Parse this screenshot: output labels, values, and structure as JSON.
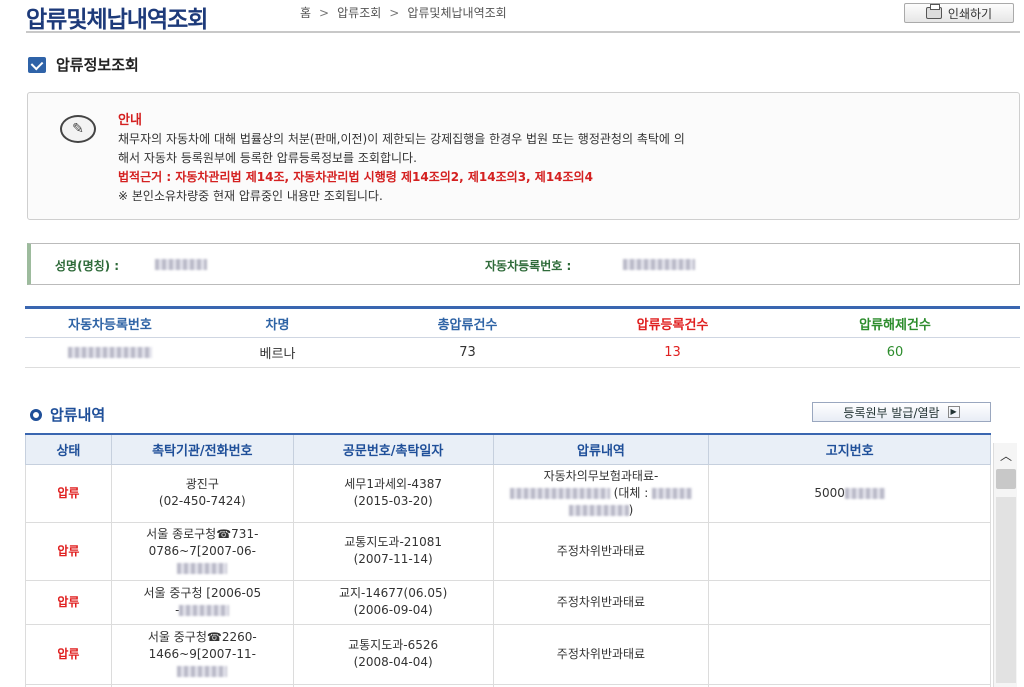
{
  "header": {
    "title": "압류및체납내역조회",
    "breadcrumb": [
      "홈",
      "압류조회",
      "압류및체납내역조회"
    ],
    "print_label": "인쇄하기"
  },
  "section": {
    "title": "압류정보조회"
  },
  "notice": {
    "title": "안내",
    "line1": "채무자의 자동차에 대해 법률상의 처분(판매,이전)이 제한되는 강제집행을 한경우 법원 또는 행정관청의 촉탁에 의",
    "line2": "해서 자동차 등록원부에 등록한 압류등록정보를 조회합니다.",
    "law": "법적근거 : 자동차관리법 제14조, 자동차관리법 시행령 제14조의2, 제14조의3, 제14조의4",
    "note": "※ 본인소유차량중 현재 압류중인 내용만 조회됩니다."
  },
  "owner": {
    "name_label": "성명(명칭) :",
    "reg_label": "자동차등록번호 :"
  },
  "summary": {
    "headers": [
      "자동차등록번호",
      "차명",
      "총압류건수",
      "압류등록건수",
      "압류해제건수"
    ],
    "car_name": "베르나",
    "total": "73",
    "registered": "13",
    "released": "60"
  },
  "list": {
    "title": "압류내역",
    "register_button": "등록원부 발급/열람",
    "headers": [
      "상태",
      "촉탁기관/전화번호",
      "공문번호/촉탁일자",
      "압류내역",
      "고지번호"
    ],
    "rows": [
      {
        "status": "압류",
        "agency": "광진구",
        "agency2": "(02-450-7424)",
        "doc": "세무1과세외-4387",
        "doc2": "(2015-03-20)",
        "detail": "자동차의무보험과태료-",
        "detail2": "(대체 :",
        "notice_no": "5000"
      },
      {
        "status": "압류",
        "agency": "서울 종로구청☎731-",
        "agency2": "0786~7[2007-06-",
        "doc": "교통지도과-21081",
        "doc2": "(2007-11-14)",
        "detail": "주정차위반과태료",
        "notice_no": ""
      },
      {
        "status": "압류",
        "agency": "서울 중구청 [2006-05",
        "agency2": "-",
        "doc": "교지-14677(06.05)",
        "doc2": "(2006-09-04)",
        "detail": "주정차위반과태료",
        "notice_no": ""
      },
      {
        "status": "압류",
        "agency": "서울 중구청☎2260-",
        "agency2": "1466~9[2007-11-",
        "doc": "교통지도과-6526",
        "doc2": "(2008-04-04)",
        "detail": "주정차위반과태료",
        "notice_no": ""
      }
    ]
  },
  "colors": {
    "title_blue": "#1d3a7a",
    "accent_blue": "#3a66b0",
    "red": "#e02020",
    "green": "#2c8c2c"
  }
}
